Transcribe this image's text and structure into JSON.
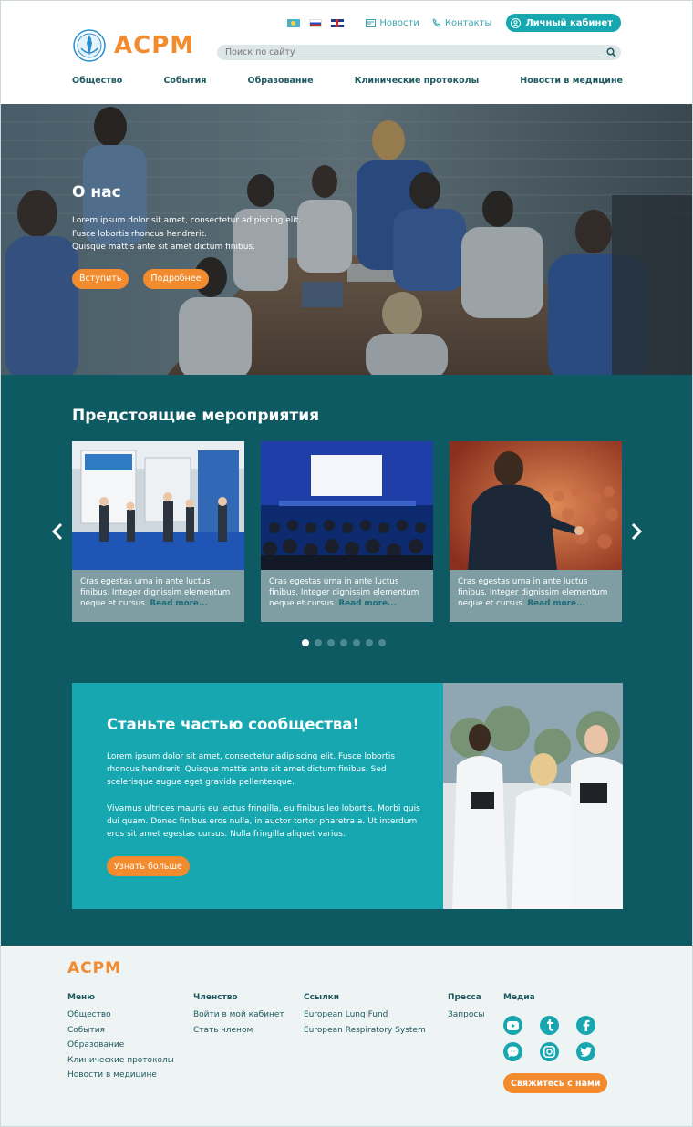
{
  "header": {
    "logo_text": "ACPM",
    "languages": [
      "kz",
      "ru",
      "en"
    ],
    "news_label": "Новости",
    "contacts_label": "Контакты",
    "cabinet_label": "Личный кабинет",
    "search_placeholder": "Поиск по сайту",
    "nav": [
      "Общество",
      "События",
      "Образование",
      "Клинические протоколы",
      "Новости в медицине"
    ]
  },
  "hero": {
    "title": "О нас",
    "line1": "Lorem ipsum dolor sit amet, consectetur adipiscing elit.",
    "line2": "Fusce lobortis rhoncus hendrerit.",
    "line3": "Quisque mattis ante sit amet dictum finibus.",
    "join_label": "Вступить",
    "more_label": "Подробнее"
  },
  "events": {
    "title": "Предстоящие мероприятия",
    "cards": [
      {
        "text": "Cras egestas urna in ante luctus finibus. Integer dignissim elementum neque et cursus.",
        "readmore": "Read more..."
      },
      {
        "text": "Cras egestas urna in ante luctus finibus. Integer dignissim elementum neque et cursus.",
        "readmore": "Read more..."
      },
      {
        "text": "Cras egestas urna in ante luctus finibus. Integer dignissim elementum neque et cursus.",
        "readmore": "Read more..."
      }
    ],
    "dots_total": 7,
    "dots_active": 1
  },
  "join": {
    "title": "Станьте частью сообщества!",
    "para1": "Lorem ipsum dolor sit amet, consectetur adipiscing elit. Fusce lobortis rhoncus hendrerit. Quisque mattis ante sit amet dictum finibus. Sed scelerisque augue eget gravida pellentesque.",
    "para2": "Vivamus ultrices mauris eu lectus fringilla, eu finibus leo lobortis. Morbi quis dui quam. Donec finibus eros nulla, in auctor tortor pharetra a. Ut interdum eros sit amet egestas cursus. Nulla fringilla aliquet varius.",
    "button": "Узнать больше"
  },
  "footer": {
    "logo_text": "ACPM",
    "menu": {
      "title": "Меню",
      "items": [
        "Общество",
        "События",
        "Образование",
        "Клинические протоколы",
        "Новости в медицине"
      ]
    },
    "membership": {
      "title": "Членство",
      "items": [
        "Войти в мой кабинет",
        "Стать членом"
      ]
    },
    "links": {
      "title": "Ссылки",
      "items": [
        "European Lung Fund",
        "European Respiratory System"
      ]
    },
    "press": {
      "title": "Пресса",
      "items": [
        "Запросы"
      ]
    },
    "media": {
      "title": "Медиа",
      "icons": [
        "youtube-icon",
        "tumblr-icon",
        "facebook-icon",
        "messenger-icon",
        "instagram-icon",
        "twitter-icon"
      ]
    },
    "contact_button": "Свяжитесь с нами"
  },
  "colors": {
    "accent": "#f28a2e",
    "teal": "#17a7b0",
    "dark_teal": "#0e5a62"
  }
}
